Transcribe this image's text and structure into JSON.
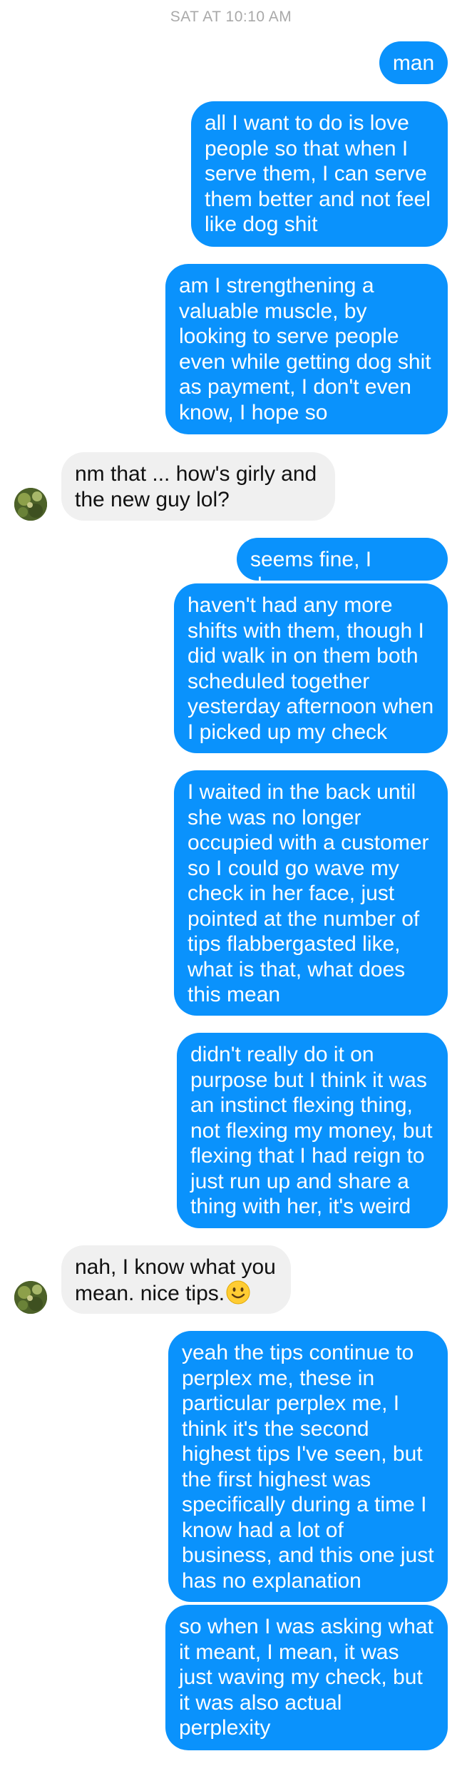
{
  "thread": {
    "timestamp": "SAT AT 10:10 AM"
  },
  "messages": [
    {
      "sender": "me",
      "text": "man"
    },
    {
      "sender": "me",
      "text": "all I want to do is love\npeople so that when I\nserve them, I can serve\nthem better and not feel\nlike dog shit"
    },
    {
      "sender": "me",
      "text": "am I strengthening a\nvaluable muscle, by\nlooking to serve people\neven while getting dog shit\nas payment, I don't even\nknow, I hope so"
    },
    {
      "sender": "them",
      "text": "nm that ... how's girly and\nthe new guy lol?"
    },
    {
      "sender": "me",
      "text": "seems fine, I dunno"
    },
    {
      "sender": "me",
      "text": "haven't had any more\nshifts with them, though I\ndid walk in on them both\nscheduled together\nyesterday afternoon when\nI picked up my check"
    },
    {
      "sender": "me",
      "text": "I waited in the back until\nshe was no longer\noccupied with a customer\nso I could go wave my\ncheck in her face, just\npointed at the number of\ntips flabbergasted like,\nwhat is that, what does\nthis mean"
    },
    {
      "sender": "me",
      "text": "didn't really do it on\npurpose but I think it was\nan instinct flexing thing,\nnot flexing my money, but\nflexing that I had reign to\njust run up and share a\nthing with her, it's weird"
    },
    {
      "sender": "them",
      "text": "nah, I know what you\nmean. nice tips.",
      "emoji": "smiling-face-emoji"
    },
    {
      "sender": "me",
      "text": "yeah the tips continue to\nperplex me, these in\nparticular perplex me, I\nthink it's the second\nhighest tips I've seen, but\nthe first highest was\nspecifically during a time I\nknow had a lot of\nbusiness, and this one just\nhas no explanation"
    },
    {
      "sender": "me",
      "text": "so when I was asking what\nit meant, I mean, it was\njust waving my check, but\nit was also actual\nperplexity"
    }
  ],
  "colors": {
    "outgoing_bubble": "#0a92fc",
    "incoming_bubble": "#f0f0f0",
    "timestamp_text": "#a9a9a9"
  }
}
